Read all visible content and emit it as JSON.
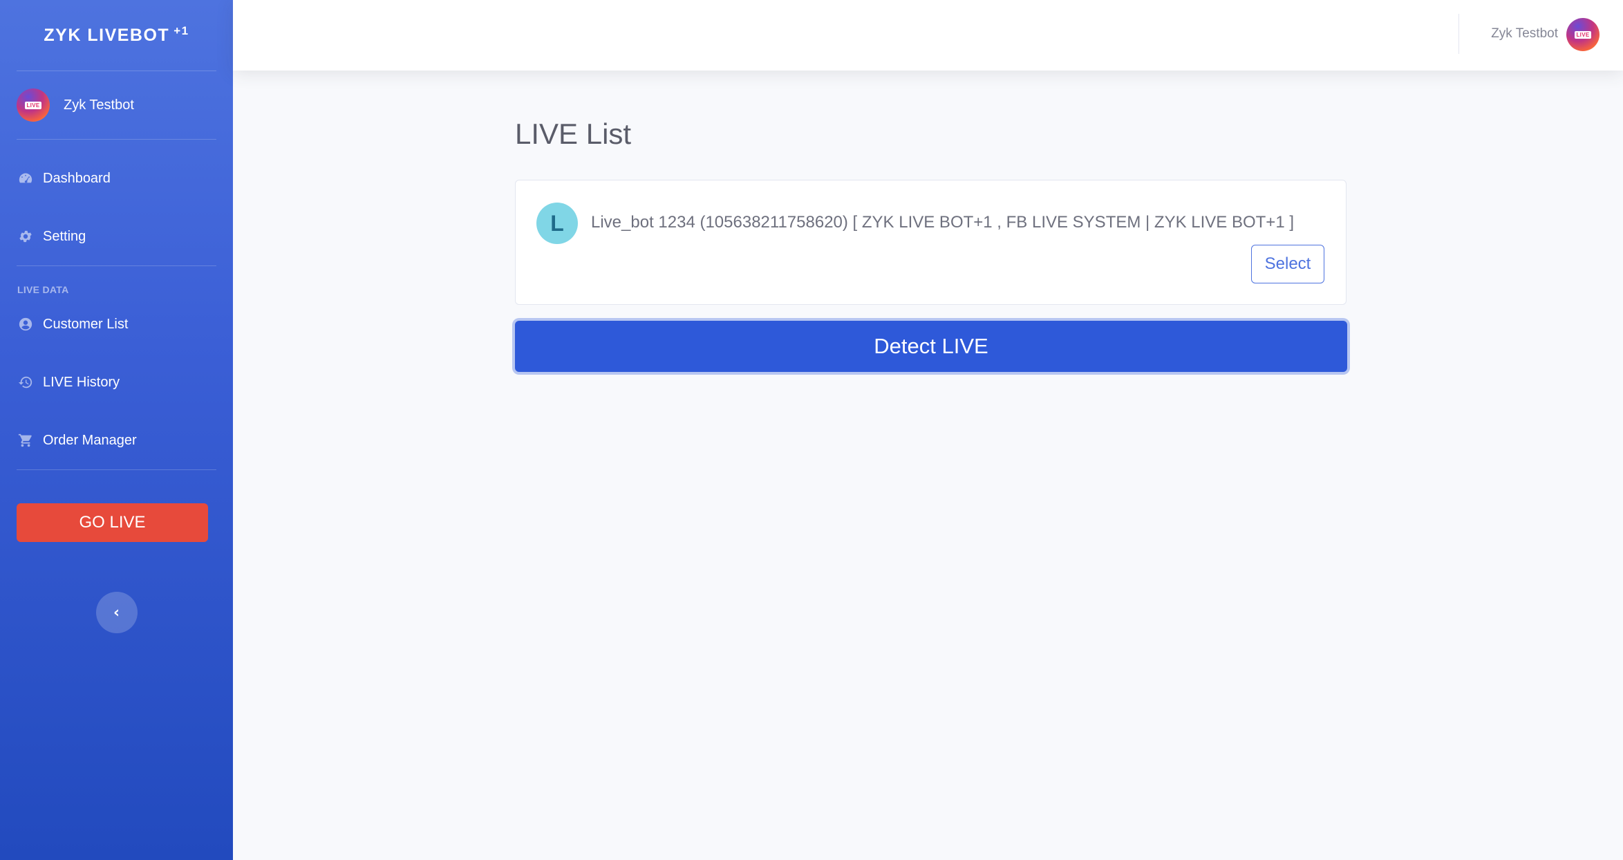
{
  "brand": {
    "name": "ZYK LIVEBOT",
    "sup": "+1"
  },
  "sidebar": {
    "user_name": "Zyk Testbot",
    "avatar_tag": "LIVE",
    "items": [
      {
        "label": "Dashboard",
        "icon": "tachometer-icon"
      },
      {
        "label": "Setting",
        "icon": "gear-icon"
      }
    ],
    "section_heading": "LIVE DATA",
    "data_items": [
      {
        "label": "Customer List",
        "icon": "user-circle-icon"
      },
      {
        "label": "LIVE History",
        "icon": "history-icon"
      },
      {
        "label": "Order Manager",
        "icon": "cart-icon"
      }
    ],
    "go_live_label": "GO LIVE",
    "toggle_glyph": "‹"
  },
  "topbar": {
    "user_name": "Zyk Testbot",
    "avatar_tag": "LIVE"
  },
  "main": {
    "title": "LIVE List",
    "pages": [
      {
        "initial": "L",
        "text": "Live_bot 1234 (105638211758620) [ ZYK LIVE BOT+1 , FB LIVE SYSTEM | ZYK LIVE BOT+1 ]",
        "select_label": "Select"
      }
    ],
    "detect_label": "Detect LIVE"
  },
  "colors": {
    "sidebar": "#4e73df",
    "go_live": "#e74a3b",
    "detect": "#2e59d9",
    "letter_avatar": "#80d6e6"
  }
}
